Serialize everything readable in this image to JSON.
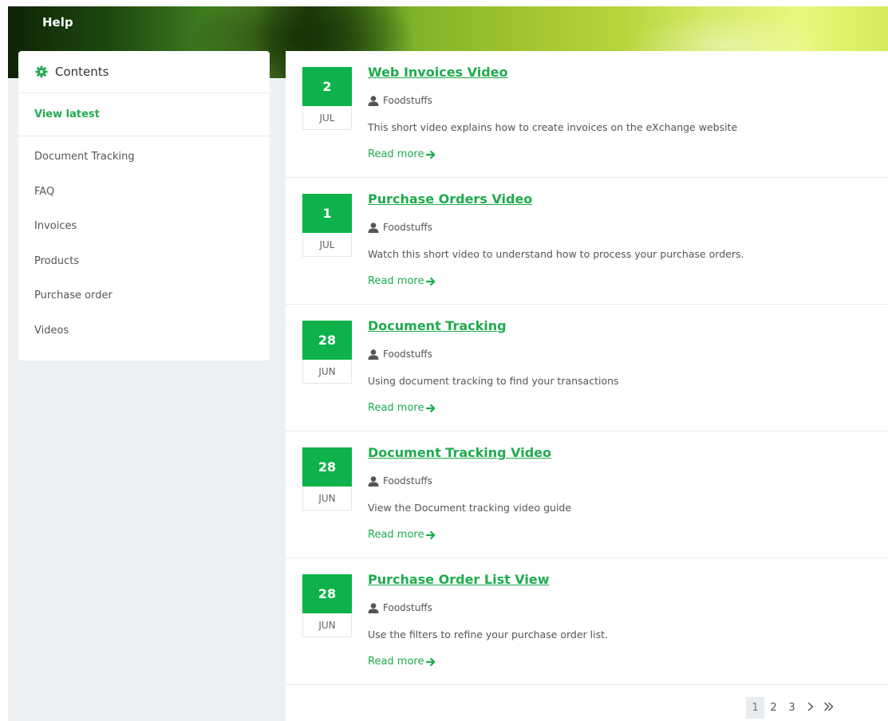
{
  "header": {
    "title": "Help"
  },
  "sidebar": {
    "title": "Contents",
    "title_icon": "gear-icon",
    "view_latest": "View latest",
    "categories": [
      {
        "label": "Document Tracking"
      },
      {
        "label": "FAQ"
      },
      {
        "label": "Invoices"
      },
      {
        "label": "Products"
      },
      {
        "label": "Purchase order"
      },
      {
        "label": "Videos"
      }
    ]
  },
  "posts": [
    {
      "day": "2",
      "month": "JUL",
      "title": "Web Invoices Video",
      "author": "Foodstuffs",
      "description": "This short video explains how to create invoices on the eXchange website",
      "read_more": "Read more"
    },
    {
      "day": "1",
      "month": "JUL",
      "title": "Purchase Orders Video",
      "author": "Foodstuffs",
      "description": "Watch this short video to understand how to process your purchase orders.",
      "read_more": "Read more"
    },
    {
      "day": "28",
      "month": "JUN",
      "title": "Document Tracking",
      "author": "Foodstuffs",
      "description": "Using document tracking to find your transactions",
      "read_more": "Read more"
    },
    {
      "day": "28",
      "month": "JUN",
      "title": "Document Tracking Video",
      "author": "Foodstuffs",
      "description": "View the Document tracking video guide",
      "read_more": "Read more"
    },
    {
      "day": "28",
      "month": "JUN",
      "title": "Purchase Order List View",
      "author": "Foodstuffs",
      "description": "Use the filters to refine your purchase order list.",
      "read_more": "Read more"
    }
  ],
  "pagination": {
    "pages": [
      "1",
      "2",
      "3"
    ],
    "current": "1",
    "next_icon": "chevron-right-icon",
    "last_icon": "double-chevron-right-icon"
  },
  "colors": {
    "accent": "#1fab4d",
    "date_badge": "#0db24a",
    "page_background": "#edf1f4"
  }
}
